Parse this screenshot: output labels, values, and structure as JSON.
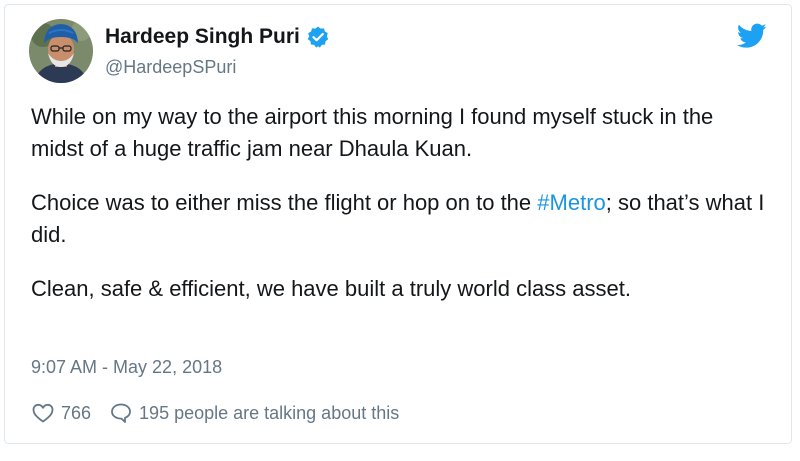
{
  "tweet": {
    "author": {
      "display_name": "Hardeep Singh Puri",
      "handle": "@HardeepSPuri",
      "verified": true
    },
    "paragraphs": [
      {
        "text": "While on my way to the airport this morning I found myself stuck in the midst of a huge traffic jam near Dhaula Kuan."
      },
      {
        "before": "Choice was to either miss the flight or hop on to the ",
        "hashtag": "#Metro",
        "after": "; so that’s what I did."
      },
      {
        "text": "Clean, safe & efficient, we have built a truly world class asset."
      }
    ],
    "timestamp": "9:07 AM - May 22, 2018",
    "likes": "766",
    "comments_text": "195 people are talking about this"
  },
  "colors": {
    "text": "#14171a",
    "secondary": "#657786",
    "link": "#1b95e0",
    "twitter_blue": "#1da1f2",
    "border": "#e1e8ed"
  },
  "icons": [
    "avatar-photo",
    "verified-badge-icon",
    "twitter-bird-icon",
    "heart-icon",
    "comment-icon"
  ]
}
